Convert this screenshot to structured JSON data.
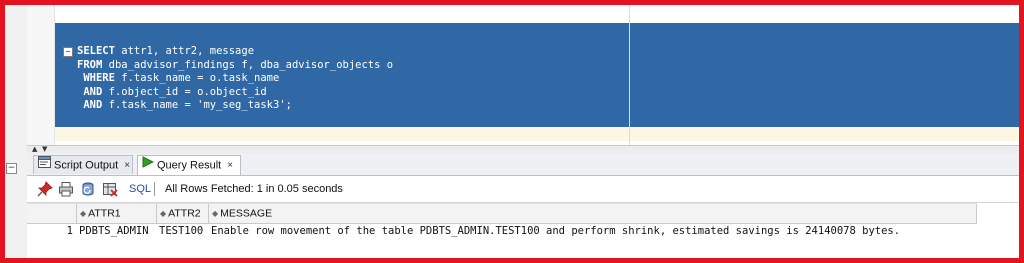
{
  "editor": {
    "lines": [
      [
        {
          "t": "SELECT",
          "kw": true
        },
        {
          "t": " attr1, attr2, message"
        }
      ],
      [
        {
          "t": "FROM",
          "kw": true
        },
        {
          "t": " dba_advisor_findings f, dba_advisor_objects o"
        }
      ],
      [
        {
          "t": " WHERE",
          "kw": true
        },
        {
          "t": " f.task_name = o.task_name"
        }
      ],
      [
        {
          "t": " AND",
          "kw": true
        },
        {
          "t": " f.object_id = o.object_id"
        }
      ],
      [
        {
          "t": " AND",
          "kw": true
        },
        {
          "t": " f.task_name = 'my_seg_task3';"
        }
      ]
    ],
    "fold_symbol": "⊟",
    "selection_color": "#2f68a4"
  },
  "tabs": [
    {
      "label": "Script Output",
      "icon": "script-output-icon",
      "close": "×"
    },
    {
      "label": "Query Result",
      "icon": "run-icon",
      "close": "×",
      "active": true
    }
  ],
  "toolbar": {
    "icons": [
      "pin-icon",
      "print-icon",
      "refresh-icon",
      "export-icon"
    ],
    "sql_label": "SQL",
    "status": "All Rows Fetched: 1 in 0.05 seconds"
  },
  "grid": {
    "columns": [
      "ATTR1",
      "ATTR2",
      "MESSAGE"
    ],
    "rows": [
      {
        "num": "1",
        "cells": [
          "PDBTS_ADMIN",
          "TEST100",
          "Enable row movement of the table PDBTS_ADMIN.TEST100 and perform shrink, estimated savings is 24140078 bytes."
        ]
      }
    ]
  },
  "colors": {
    "frame": "#e3141f",
    "accent": "#2f68a4"
  }
}
